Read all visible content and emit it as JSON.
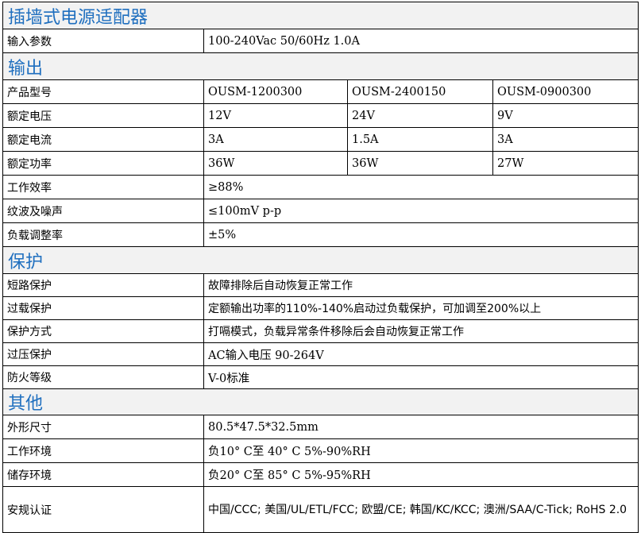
{
  "title": "插墙式电源适配器",
  "input": {
    "label": "输入参数",
    "value": "100-240Vac 50/60Hz 1.0A"
  },
  "output": {
    "section": "输出",
    "model": {
      "label": "产品型号",
      "values": [
        "OUSM-1200300",
        "OUSM-2400150",
        "OUSM-0900300"
      ]
    },
    "voltage": {
      "label": "额定电压",
      "values": [
        "12V",
        "24V",
        "9V"
      ]
    },
    "current": {
      "label": "额定电流",
      "values": [
        "3A",
        "1.5A",
        "3A"
      ]
    },
    "power": {
      "label": "额定功率",
      "values": [
        "36W",
        "36W",
        "27W"
      ]
    },
    "efficiency": {
      "label": "工作效率",
      "value": "≥88%"
    },
    "ripple": {
      "label": "纹波及噪声",
      "value": "≤100mV p-p"
    },
    "regulation": {
      "label": "负载调整率",
      "value": "±5%"
    }
  },
  "protection": {
    "section": "保护",
    "short": {
      "label": "短路保护",
      "value": "故障排除后自动恢复正常工作"
    },
    "overload": {
      "label": "过载保护",
      "value": "定额输出功率的110%-140%启动过负载保护，可加调至200%以上"
    },
    "mode": {
      "label": "保护方式",
      "value": "打嗝模式，负载异常条件移除后会自动恢复正常工作"
    },
    "overvoltage": {
      "label": "过压保护",
      "value": "AC输入电压 90-264V"
    },
    "fire": {
      "label": "防火等级",
      "value": "V-0标准"
    }
  },
  "other": {
    "section": "其他",
    "size": {
      "label": "外形尺寸",
      "value": "80.5*47.5*32.5mm"
    },
    "work_env": {
      "label": "工作环境",
      "value": "负10° C至 40° C  5%-90%RH"
    },
    "storage_env": {
      "label": "储存环境",
      "value": "负20° C至 85° C  5%-95%RH"
    },
    "cert": {
      "label": "安规认证",
      "value": "中国/CCC; 美国/UL/ETL/FCC; 欧盟/CE; 韩国/KC/KCC;  澳洲/SAA/C-Tick; RoHS 2.0"
    }
  }
}
